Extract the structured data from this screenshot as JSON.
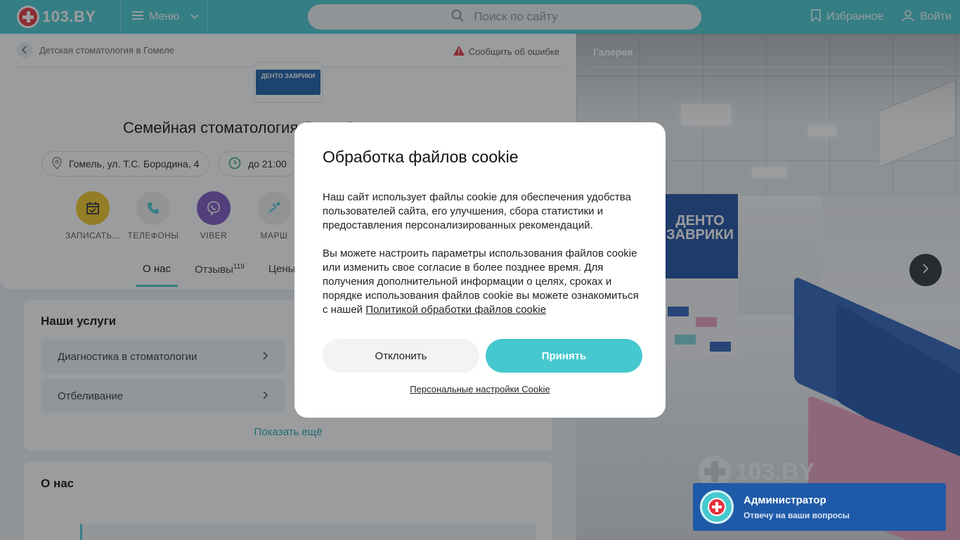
{
  "header": {
    "logo_text": "103.BY",
    "menu_label": "Меню",
    "search_placeholder": "Поиск по сайту",
    "favorites_label": "Избранное",
    "login_label": "Войти",
    "accent_color": "#45c9cf"
  },
  "breadcrumb": {
    "label": "Детская стоматология в Гомеле"
  },
  "report_error_label": "Сообщить об ошибке",
  "clinic": {
    "logo_text": "ДЕНТО ЗАВРИКИ",
    "title": "Семейная стоматология ДентоЗаврики",
    "address": "Гомель, ул. Т.С. Бородина, 4",
    "hours": "до 21:00"
  },
  "actions": [
    {
      "label": "ЗАПИСАТЬ...",
      "icon": "calendar-check-icon",
      "color": "#f3c623"
    },
    {
      "label": "ТЕЛЕФОНЫ",
      "icon": "phone-icon",
      "color": "#eeeeee"
    },
    {
      "label": "VIBER",
      "icon": "viber-icon",
      "color": "#7e57c2"
    },
    {
      "label": "МАРШ",
      "icon": "route-icon",
      "color": "#eeeeee"
    }
  ],
  "tabs": [
    {
      "label": "О нас"
    },
    {
      "label": "Отзывы",
      "count": "119"
    },
    {
      "label": "Цены"
    }
  ],
  "services": {
    "title": "Наши услуги",
    "items": [
      {
        "label": "Диагностика в стоматологии"
      },
      {
        "label": "Отбеливание"
      }
    ],
    "show_more": "Показать ещё"
  },
  "about": {
    "title": "О нас"
  },
  "gallery": {
    "label": "Галерея",
    "watermark": "103.BY",
    "sign_text": "ДЕНТО ЗАВРИКИ"
  },
  "admin_widget": {
    "name": "Администратор",
    "subtitle": "Отвечу на ваши вопросы"
  },
  "cookie_modal": {
    "title": "Обработка файлов cookie",
    "paragraph1": "Наш сайт использует файлы cookie для обеспечения удобства пользователей сайта, его улучшения, сбора статистики и предоставления персонализированных рекомендаций.",
    "paragraph2": "Вы можете настроить параметры использования файлов cookie или изменить свое согласие в более позднее время. Для получения дополнительной информации о целях, сроках и порядке использования файлов cookie вы можете ознакомиться с нашей",
    "policy_link": "Политикой обработки файлов cookie",
    "decline_label": "Отклонить",
    "accept_label": "Принять",
    "settings_link": "Персональные настройки Cookie"
  }
}
